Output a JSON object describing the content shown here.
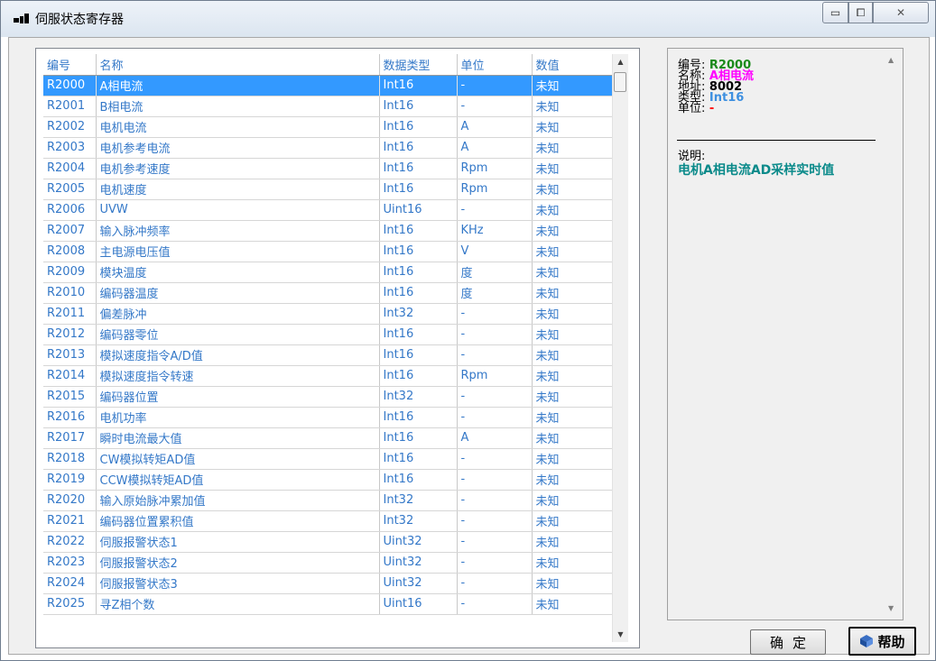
{
  "window": {
    "title": "伺服状态寄存器",
    "controls": {
      "minimize": "▭",
      "maximize": "⧠",
      "close": "✕"
    }
  },
  "table": {
    "columns": [
      "编号",
      "名称",
      "数据类型",
      "单位",
      "数值"
    ],
    "selected_index": 0,
    "rows": [
      [
        "R2000",
        "A相电流",
        "Int16",
        "-",
        "未知"
      ],
      [
        "R2001",
        "B相电流",
        "Int16",
        "-",
        "未知"
      ],
      [
        "R2002",
        "电机电流",
        "Int16",
        "A",
        "未知"
      ],
      [
        "R2003",
        "电机参考电流",
        "Int16",
        "A",
        "未知"
      ],
      [
        "R2004",
        "电机参考速度",
        "Int16",
        "Rpm",
        "未知"
      ],
      [
        "R2005",
        "电机速度",
        "Int16",
        "Rpm",
        "未知"
      ],
      [
        "R2006",
        "UVW",
        "Uint16",
        "-",
        "未知"
      ],
      [
        "R2007",
        "输入脉冲频率",
        "Int16",
        "KHz",
        "未知"
      ],
      [
        "R2008",
        "主电源电压值",
        "Int16",
        "V",
        "未知"
      ],
      [
        "R2009",
        "模块温度",
        "Int16",
        "度",
        "未知"
      ],
      [
        "R2010",
        "编码器温度",
        "Int16",
        "度",
        "未知"
      ],
      [
        "R2011",
        "偏差脉冲",
        "Int32",
        "-",
        "未知"
      ],
      [
        "R2012",
        "编码器零位",
        "Int16",
        "-",
        "未知"
      ],
      [
        "R2013",
        "模拟速度指令A/D值",
        "Int16",
        "-",
        "未知"
      ],
      [
        "R2014",
        "模拟速度指令转速",
        "Int16",
        "Rpm",
        "未知"
      ],
      [
        "R2015",
        "编码器位置",
        "Int32",
        "-",
        "未知"
      ],
      [
        "R2016",
        "电机功率",
        "Int16",
        "-",
        "未知"
      ],
      [
        "R2017",
        "瞬时电流最大值",
        "Int16",
        "A",
        "未知"
      ],
      [
        "R2018",
        "CW模拟转矩AD值",
        "Int16",
        "-",
        "未知"
      ],
      [
        "R2019",
        "CCW模拟转矩AD值",
        "Int16",
        "-",
        "未知"
      ],
      [
        "R2020",
        "输入原始脉冲累加值",
        "Int32",
        "-",
        "未知"
      ],
      [
        "R2021",
        "编码器位置累积值",
        "Int32",
        "-",
        "未知"
      ],
      [
        "R2022",
        "伺服报警状态1",
        "Uint32",
        "-",
        "未知"
      ],
      [
        "R2023",
        "伺服报警状态2",
        "Uint32",
        "-",
        "未知"
      ],
      [
        "R2024",
        "伺服报警状态3",
        "Uint32",
        "-",
        "未知"
      ],
      [
        "R2025",
        "寻Z相个数",
        "Uint16",
        "-",
        "未知"
      ]
    ]
  },
  "detail": {
    "id_label": "编号:",
    "id_value": "R2000",
    "id_color": "#1a8a1a",
    "name_label": "名称:",
    "name_value": "A相电流",
    "name_color": "#ff00ff",
    "addr_label": "地址:",
    "addr_value": "8002",
    "addr_color": "#000000",
    "type_label": "类型:",
    "type_value": "Int16",
    "type_color": "#3d8fe0",
    "unit_label": "单位:",
    "unit_value": "-",
    "unit_color": "#ff0000",
    "note_label": "说明:",
    "note_value": "电机A相电流AD采样实时值"
  },
  "buttons": {
    "ok": "确定",
    "help": "帮助"
  }
}
